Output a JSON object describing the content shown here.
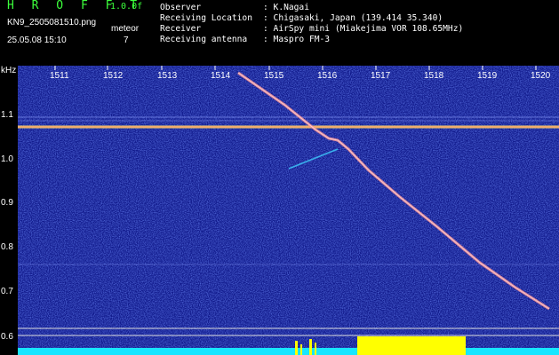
{
  "header": {
    "brand": "H R O F F T",
    "version": "1.0.0f",
    "filename": "KN9_2505081510.png",
    "meteor_label": "meteor",
    "datetime": "25.05.08 15:10",
    "meteor_count": "7",
    "info": [
      {
        "label": "Observer",
        "value": ": K.Nagai"
      },
      {
        "label": "Receiving Location",
        "value": ": Chigasaki, Japan (139.414 35.340)"
      },
      {
        "label": "Receiver",
        "value": ": AirSpy mini (Miakejima VOR 108.65MHz)"
      },
      {
        "label": "Receiving antenna",
        "value": ": Maspro FM-3"
      }
    ]
  },
  "axes": {
    "y_unit": "kHz",
    "y_ticks": [
      "1.1",
      "1.0",
      "0.9",
      "0.8",
      "0.7",
      "0.6"
    ],
    "x_ticks": [
      "1511",
      "1512",
      "1513",
      "1514",
      "1515",
      "1516",
      "1517",
      "1518",
      "1519",
      "1520"
    ]
  },
  "colors": {
    "background": "#111a8c",
    "carrier": "#ffe066",
    "trail": "#ff9090",
    "spectrum_base": "#17e6ff",
    "spectrum_peak": "#ffff00"
  }
}
